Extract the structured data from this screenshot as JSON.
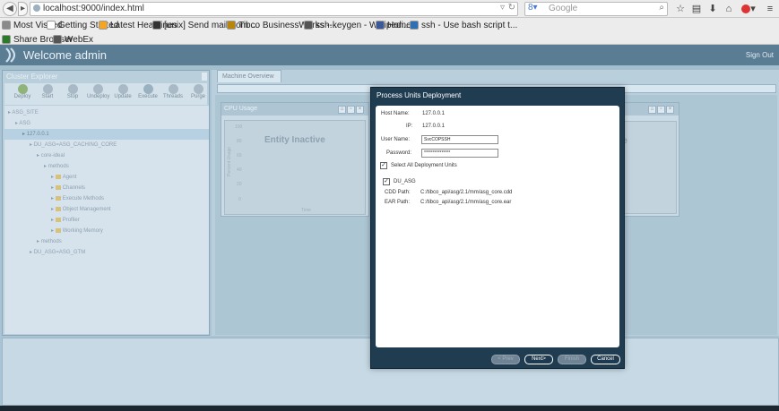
{
  "browser": {
    "url": "localhost:9000/index.html",
    "search_placeholder": "Google",
    "bookmarks": [
      {
        "label": "Most Visited",
        "icon": "gear-icon",
        "color": "#8a8a8a"
      },
      {
        "label": "Getting Started",
        "icon": "page-icon",
        "color": "#ffffff"
      },
      {
        "label": "Latest Headlines",
        "icon": "rss-icon",
        "color": "#f4a623"
      },
      {
        "label": "[unix] Send mail from ...",
        "icon": "unix-icon",
        "color": "#333333"
      },
      {
        "label": "Tibco BusinessWorks -...",
        "icon": "tibco-icon",
        "color": "#b8860b"
      },
      {
        "label": "ssh-keygen - Wikipedi...",
        "icon": "wikipedia-icon",
        "color": "#555555"
      },
      {
        "label": "Home1",
        "icon": "facebook-icon",
        "color": "#3b5998"
      },
      {
        "label": "ssh - Use bash script t...",
        "icon": "stackexchange-icon",
        "color": "#2f6fb3"
      }
    ],
    "bookmarks2": [
      {
        "label": "Share Browser",
        "icon": "share-icon",
        "color": "#2a7a2a"
      },
      {
        "label": "WebEx",
        "icon": "webex-icon",
        "color": "#555555"
      }
    ]
  },
  "app": {
    "welcome": "Welcome admin",
    "sign_out": "Sign Out",
    "explorer_title": "Cluster Explorer",
    "toolbar": [
      "Deploy",
      "Start",
      "Stop",
      "Undeploy",
      "Update",
      "Execute",
      "Threads",
      "Purge"
    ],
    "tree": [
      {
        "label": "ASG_SITE",
        "indent": 0,
        "selected": false,
        "folder": false
      },
      {
        "label": "ASG",
        "indent": 1,
        "selected": false,
        "folder": false
      },
      {
        "label": "127.0.0.1",
        "indent": 2,
        "selected": true,
        "folder": false
      },
      {
        "label": "DU_ASG=ASG_CACHING_CORE",
        "indent": 3,
        "selected": false,
        "folder": false
      },
      {
        "label": "core-ideal",
        "indent": 4,
        "selected": false,
        "folder": false
      },
      {
        "label": "methods",
        "indent": 5,
        "selected": false,
        "folder": false
      },
      {
        "label": "Agent",
        "indent": 6,
        "selected": false,
        "folder": true
      },
      {
        "label": "Channels",
        "indent": 6,
        "selected": false,
        "folder": true
      },
      {
        "label": "Execute Methods",
        "indent": 6,
        "selected": false,
        "folder": true
      },
      {
        "label": "Object Management",
        "indent": 6,
        "selected": false,
        "folder": true
      },
      {
        "label": "Profiler",
        "indent": 6,
        "selected": false,
        "folder": true
      },
      {
        "label": "Working Memory",
        "indent": 6,
        "selected": false,
        "folder": true
      },
      {
        "label": "methods",
        "indent": 4,
        "selected": false,
        "folder": false
      },
      {
        "label": "DU_ASG=ASG_GTM",
        "indent": 3,
        "selected": false,
        "folder": false
      }
    ],
    "tab": "Machine Overview",
    "widgets": [
      {
        "title": "CPU Usage",
        "status": "Entity Inactive",
        "x_label": "Time",
        "y_label": "Percent Usage",
        "y_ticks": [
          "100",
          "80",
          "60",
          "40",
          "20",
          "0"
        ]
      },
      {
        "status": "ive"
      }
    ]
  },
  "modal": {
    "title": "Process Units Deployment",
    "host_label": "Host Name:",
    "host_value": "127.0.0.1",
    "ip_label": "IP:",
    "ip_value": "127.0.0.1",
    "user_label": "User Name:",
    "user_value": "SvcCOPSSH",
    "password_label": "Password:",
    "password_value": "***************",
    "select_all_label": "Select All Deployment Units",
    "select_all_checked": true,
    "unit_label": "DU_ASG",
    "unit_checked": true,
    "cdd_label": "CDD Path:",
    "cdd_value": "C:/tibco_api/asg/2.1/mm/asg_core.cdd",
    "ear_label": "EAR Path:",
    "ear_value": "C:/tibco_api/asg/2.1/mm/asg_core.ear",
    "buttons": {
      "prev": "< Prev",
      "next": "Next>",
      "finish": "Finish",
      "cancel": "Cancel"
    }
  }
}
